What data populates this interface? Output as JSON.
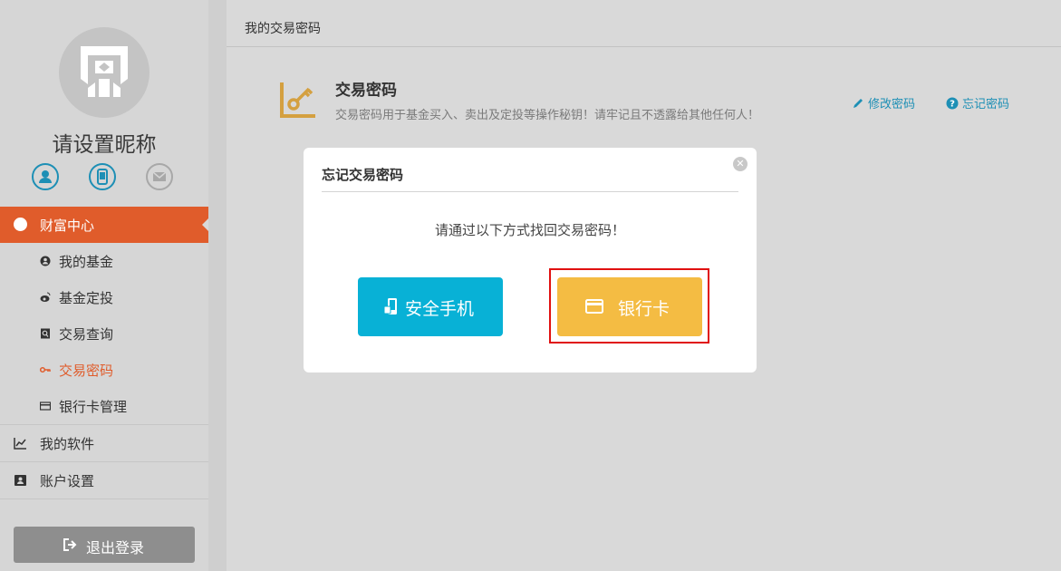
{
  "sidebar": {
    "nickname": "请设置昵称",
    "verify_icons": [
      "person-icon",
      "phone-icon",
      "mail-icon"
    ],
    "section_label": "财富中心",
    "sub_items": [
      {
        "label": "我的基金",
        "icon": "user-circle-icon"
      },
      {
        "label": "基金定投",
        "icon": "weibo-icon"
      },
      {
        "label": "交易查询",
        "icon": "search-doc-icon"
      },
      {
        "label": "交易密码",
        "icon": "key-icon",
        "active": true
      },
      {
        "label": "银行卡管理",
        "icon": "card-icon"
      }
    ],
    "top_items": [
      {
        "label": "我的软件",
        "icon": "chart-icon"
      },
      {
        "label": "账户设置",
        "icon": "id-card-icon"
      }
    ],
    "logout_label": "退出登录"
  },
  "header": {
    "title": "我的交易密码"
  },
  "password_section": {
    "title": "交易密码",
    "description": "交易密码用于基金买入、卖出及定投等操作秘钥！请牢记且不透露给其他任何人！",
    "modify_link": "修改密码",
    "forgot_link": "忘记密码"
  },
  "modal": {
    "title": "忘记交易密码",
    "message": "请通过以下方式找回交易密码！",
    "phone_button": "安全手机",
    "card_button": "银行卡"
  },
  "colors": {
    "accent": "#e05c2b",
    "link": "#1d8fb5",
    "phone_button": "#08b1d6",
    "card_button": "#f4bc43",
    "highlight": "#e01010"
  }
}
